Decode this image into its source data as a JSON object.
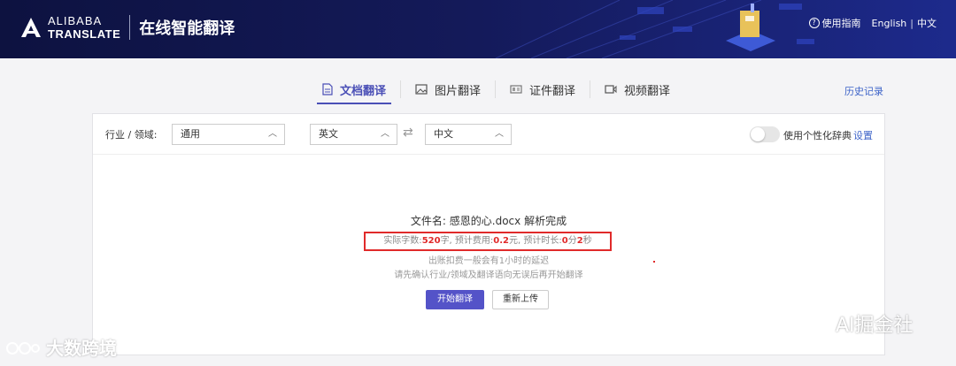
{
  "header": {
    "logo_line1": "ALIBABA",
    "logo_line2": "TRANSLATE",
    "app_title": "在线智能翻译",
    "help_label": "使用指南",
    "lang_en": "English",
    "lang_sep": "|",
    "lang_zh": "中文",
    "bg_color": "#0d1240"
  },
  "tabs": [
    {
      "label": "文档翻译",
      "icon": "document-icon",
      "active": true
    },
    {
      "label": "图片翻译",
      "icon": "image-icon",
      "active": false
    },
    {
      "label": "证件翻译",
      "icon": "id-card-icon",
      "active": false
    },
    {
      "label": "视频翻译",
      "icon": "video-icon",
      "active": false
    }
  ],
  "history_label": "历史记录",
  "toolbar": {
    "industry_label": "行业 / 领域:",
    "industry_value": "通用",
    "source_lang": "英文",
    "target_lang": "中文",
    "dict_label": "使用个性化辞典",
    "dict_enabled": false,
    "settings_label": "设置"
  },
  "result": {
    "filename_line": "文件名: 感恩的心.docx 解析完成",
    "stats_prefix1": "实际字数:",
    "word_count": "520",
    "stats_suffix1": "字, 预计费用:",
    "cost": "0.2",
    "stats_suffix2": "元, 预计时长:",
    "minutes": "0",
    "stats_min_unit": "分",
    "seconds": "2",
    "stats_sec_unit": "秒",
    "note1": "出账扣费一般会有1小时的延迟",
    "note2": "请先确认行业/领域及翻译语向无误后再开始翻译",
    "start_button": "开始翻译",
    "reupload_button": "重新上传"
  },
  "watermarks": {
    "left": "大数跨境",
    "right": "AI掘金社"
  },
  "colors": {
    "accent": "#4a4fb6",
    "button": "#5453c8",
    "link": "#3d63c8",
    "highlight": "#e02a2a"
  }
}
